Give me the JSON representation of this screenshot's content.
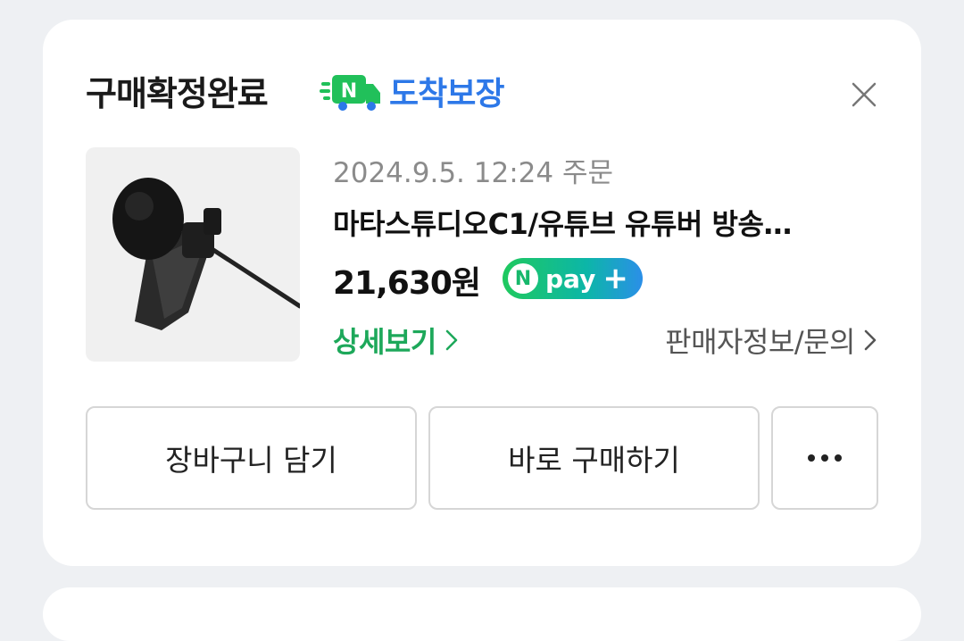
{
  "card": {
    "title": "구매확정완료",
    "badge": {
      "icon": "n-delivery-truck-icon",
      "n_letter": "N",
      "text": "도착보장",
      "color": "#2d78e8"
    },
    "close_icon": "close-icon"
  },
  "product": {
    "order_date": "2024.9.5. 12:24 주문",
    "name": "마타스튜디오C1/유튜브 유튜버 방송…",
    "price": "21,630원",
    "npay": {
      "n_letter": "N",
      "text": "pay",
      "plus": "+"
    },
    "detail_link": "상세보기",
    "seller_link": "판매자정보/문의",
    "thumbnail": "lavalier-microphone-image"
  },
  "actions": {
    "cart": "장바구니 담기",
    "buy_now": "바로 구매하기",
    "more_icon": "more-dots-icon"
  },
  "colors": {
    "accent_green": "#1da85a",
    "brand_blue": "#2d78e8",
    "background": "#eef0f3"
  }
}
